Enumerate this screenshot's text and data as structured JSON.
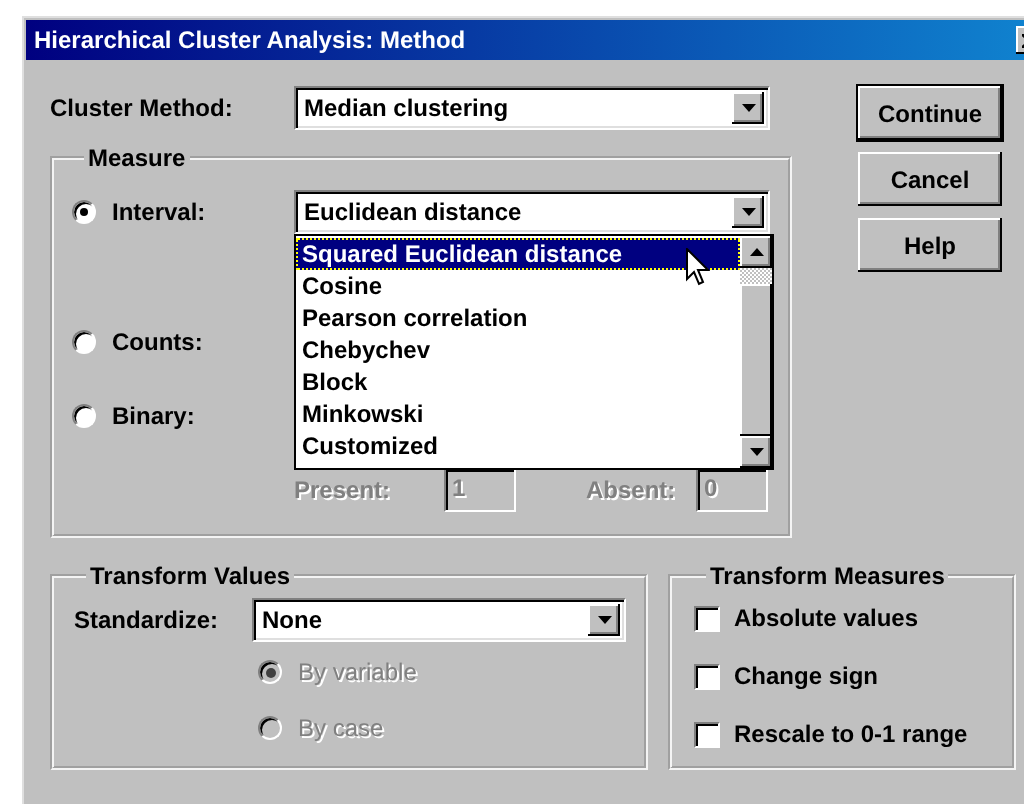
{
  "window": {
    "title": "Hierarchical Cluster Analysis: Method"
  },
  "cluster_method": {
    "label": "Cluster Method:",
    "value": "Median clustering"
  },
  "buttons": [
    {
      "label": "Continue",
      "default": true
    },
    {
      "label": "Cancel",
      "default": false
    },
    {
      "label": "Help",
      "default": false
    }
  ],
  "measure": {
    "title": "Measure",
    "options": [
      {
        "label": "Interval:",
        "selected": true
      },
      {
        "label": "Counts:",
        "selected": false
      },
      {
        "label": "Binary:",
        "selected": false
      }
    ],
    "interval_value": "Euclidean distance",
    "dropdown_items": [
      {
        "label": "Squared Euclidean distance",
        "selected": true
      },
      {
        "label": "Cosine",
        "selected": false
      },
      {
        "label": "Pearson correlation",
        "selected": false
      },
      {
        "label": "Chebychev",
        "selected": false
      },
      {
        "label": "Block",
        "selected": false
      },
      {
        "label": "Minkowski",
        "selected": false
      },
      {
        "label": "Customized",
        "selected": false
      }
    ],
    "present": {
      "label": "Present:",
      "value": "1",
      "disabled": true
    },
    "absent": {
      "label": "Absent:",
      "value": "0",
      "disabled": true
    }
  },
  "transform_values": {
    "title": "Transform Values",
    "standardize": {
      "label": "Standardize:",
      "value": "None"
    },
    "options": [
      {
        "label": "By variable",
        "selected": true,
        "disabled": true
      },
      {
        "label": "By case",
        "selected": false,
        "disabled": true
      }
    ]
  },
  "transform_measures": {
    "title": "Transform Measures",
    "options": [
      {
        "label": "Absolute values",
        "checked": false
      },
      {
        "label": "Change sign",
        "checked": false
      },
      {
        "label": "Rescale to 0-1 range",
        "checked": false
      }
    ]
  }
}
